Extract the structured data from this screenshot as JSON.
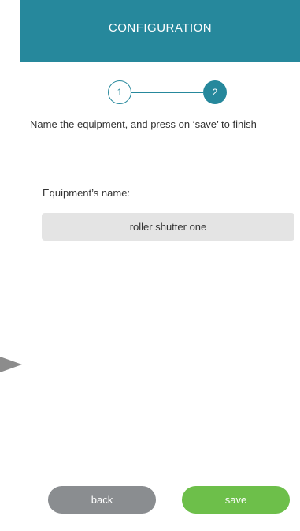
{
  "header": {
    "title": "CONFIGURATION"
  },
  "stepper": {
    "step1": "1",
    "step2": "2",
    "current_step": 2
  },
  "instruction": "Name the equipment, and press on ‘save’ to finish",
  "form": {
    "label": "Equipment’s name:",
    "value": "roller shutter one"
  },
  "buttons": {
    "back_label": "back",
    "save_label": "save"
  },
  "colors": {
    "primary": "#26889c",
    "save": "#6dbf4a",
    "back": "#8a8d90",
    "input_bg": "#e4e4e4"
  }
}
